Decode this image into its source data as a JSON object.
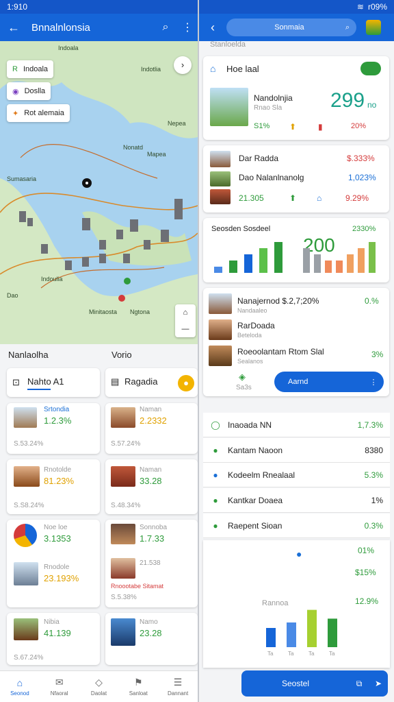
{
  "status": {
    "time": "1:910",
    "right": "r09%"
  },
  "left": {
    "title": "Bnnalnlonsia",
    "chips": [
      "Indoala",
      "Doslla",
      "Rot alemaia"
    ],
    "map_labels": [
      "Indoala",
      "Indotlia",
      "Nepea",
      "Sumasaria",
      "Nonatd",
      "Mapea",
      "Indoulia",
      "Ngtona",
      "Minitaosta",
      "Dao"
    ],
    "section_left": "Nanlaolha",
    "section_right": "Vorio",
    "cards": [
      {
        "title": "Nahto A1"
      },
      {
        "title": "Ragadia"
      },
      {
        "name": "Srtondia",
        "value": "1.2.3%",
        "sub": "S.53.24%"
      },
      {
        "name": "Naman",
        "value": "2.2332",
        "sub": "S.57.24%"
      },
      {
        "name": "Rnotolde",
        "value": "81.23%",
        "sub": "S.S8.24%"
      },
      {
        "name": "Naman",
        "value": "33.28",
        "sub": "S.48.34%"
      },
      {
        "name": "Noe loe",
        "value": "3.1353",
        "sub": ""
      },
      {
        "name": "Sonnoba",
        "value": "1.7.33",
        "sub": ""
      },
      {
        "name": "Rnodole",
        "value": "23.193%",
        "sub": ""
      },
      {
        "name": "Rnoootabe Sitamat",
        "value": "21.538",
        "sub": "S.5.38%"
      },
      {
        "name": "Nibia",
        "value": "41.139",
        "sub": "S.67.24%"
      },
      {
        "name": "Namo",
        "value": "23.28",
        "sub": ""
      }
    ],
    "nav": [
      "Seonod",
      "Nfaoral",
      "Daolat",
      "Sanloat",
      "Dannant"
    ]
  },
  "right": {
    "search": "Sonmaia",
    "section": "Stanloelda",
    "hot": {
      "title": "Hoe laal",
      "name": "Nandolnjia",
      "sub": "Rnao Sla",
      "big": "299",
      "big_unit": "no",
      "pct1": "S1%",
      "pct2": "20%"
    },
    "list": [
      {
        "name": "Dar Radda",
        "val": "$.333%"
      },
      {
        "name": "Dao Nalanlnanolg",
        "val": "1,023%"
      },
      {
        "name": "21.305",
        "val": "9.29%"
      }
    ],
    "chart1": {
      "title": "Seosden Sosdeel",
      "pct": "2330%",
      "big": "200"
    },
    "cards2": [
      {
        "name": "Nanajernod $.2,7;20%",
        "val": "0.%",
        "sub": "Nandaaleo"
      },
      {
        "name": "RarDoada",
        "val": "",
        "sub": "Beteloda"
      },
      {
        "name": "Roeoolantam Rtom Slal",
        "val": "3%",
        "sub": "Sealanos"
      }
    ],
    "sub_small": "Sa3s",
    "action": "Aarnd",
    "rows": [
      {
        "name": "Inaoada NN",
        "val": "1,7.3%"
      },
      {
        "name": "Kantam Naoon",
        "val": "8380"
      },
      {
        "name": "Kodeelm Rnealaal",
        "val": "5.3%"
      },
      {
        "name": "Kantkar Doaea",
        "val": "1%"
      },
      {
        "name": "Raepent Sioan",
        "val": "0.3%"
      }
    ],
    "side_vals": [
      "01%",
      "$15%"
    ],
    "chart2": {
      "title": "Rannoa",
      "pct": "12.9%",
      "labels": [
        "Ta",
        "Ta",
        "Ta",
        "Ta"
      ]
    },
    "bottom_btn": "Seostel"
  },
  "chart_data": [
    {
      "type": "bar",
      "title": "Seosden Sosdeel",
      "values": [
        1,
        2,
        3,
        4,
        5,
        4,
        3,
        2,
        2,
        3,
        4,
        5
      ],
      "note": "200"
    },
    {
      "type": "bar",
      "title": "Rannoa",
      "categories": [
        "Ta",
        "Ta",
        "Ta",
        "Ta"
      ],
      "values": [
        35,
        45,
        68,
        52
      ]
    }
  ],
  "colors": {
    "primary": "#1565d8",
    "green": "#2e9b3b",
    "yellow": "#e0a100",
    "red": "#d43b3b"
  }
}
